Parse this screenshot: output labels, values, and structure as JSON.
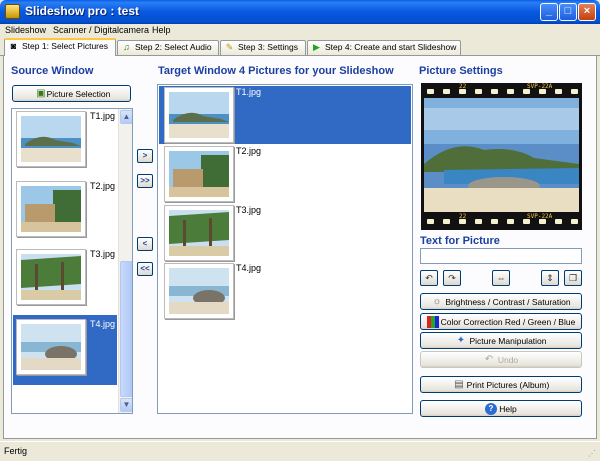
{
  "window": {
    "title": "Slideshow pro : test",
    "buttons": {
      "minimize": "_",
      "maximize": "□",
      "close": "×"
    }
  },
  "menu": [
    {
      "label": "Slideshow"
    },
    {
      "label": "Scanner / Digitalcamera"
    },
    {
      "label": "Help"
    }
  ],
  "tabs": [
    {
      "label": "Step 1: Select Pictures",
      "icon": "camera-icon",
      "active": true
    },
    {
      "label": "Step 2: Select Audio",
      "icon": "audio-icon",
      "active": false
    },
    {
      "label": "Step 3: Settings",
      "icon": "settings-icon",
      "active": false
    },
    {
      "label": "Step 4: Create and start Slideshow",
      "icon": "play-icon",
      "active": false
    }
  ],
  "source": {
    "heading": "Source Window",
    "button": "Picture Selection",
    "files": [
      "T1.jpg",
      "T2.jpg",
      "T3.jpg",
      "T4.jpg"
    ],
    "selected": "T4.jpg"
  },
  "transfer_buttons": {
    "add_one": ">",
    "add_all": ">>",
    "remove_one": "<",
    "remove_all": "<<"
  },
  "target": {
    "heading": "Target Window 4 Pictures for your Slideshow",
    "files": [
      "T1.jpg",
      "T2.jpg",
      "T3.jpg",
      "T4.jpg"
    ],
    "selected": "T1.jpg"
  },
  "settings": {
    "heading": "Picture Settings",
    "film_top_left": "22",
    "film_top_right": "SVP-22A",
    "film_bottom_left": "22",
    "film_bottom_right": "SVP-22A",
    "text_label": "Text for Picture",
    "text_value": "",
    "buttons": {
      "brightness": "Brightness / Contrast / Saturation",
      "color": "Color Correction Red / Green / Blue",
      "manipulation": "Picture Manipulation",
      "undo": "Undo",
      "print": "Print Pictures (Album)",
      "help": "Help"
    }
  },
  "status": {
    "text": "Fertig"
  },
  "colors": {
    "selection": "#316ac5",
    "heading": "#1c3fa0",
    "titlebar": "#0858e0"
  }
}
